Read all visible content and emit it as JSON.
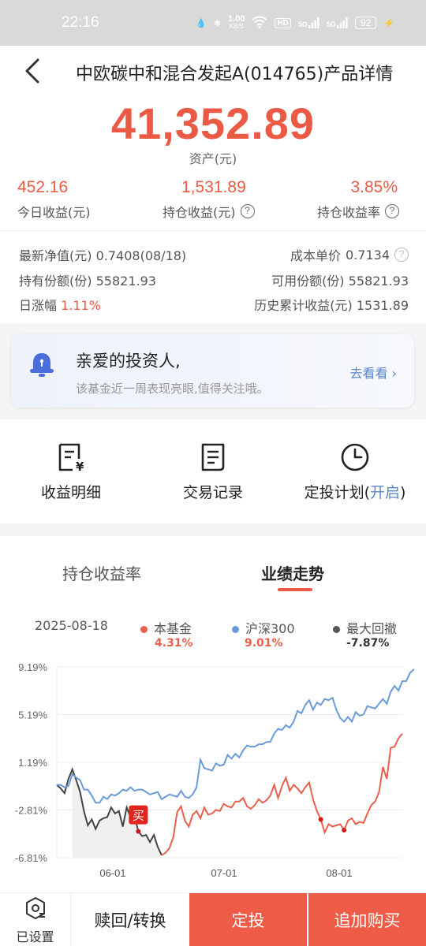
{
  "status_bar": {
    "time": "22:16",
    "net_speed_top": "1.00",
    "net_speed_unit": "KB/S",
    "hd_badge": "HD",
    "sig1": "5G",
    "sig2": "5G",
    "battery": "92"
  },
  "header": {
    "title": "中欧碳中和混合发起A(014765)产品详情"
  },
  "summary": {
    "total_asset": "41,352.89",
    "asset_label": "资产(元)",
    "today_value": "452.16",
    "today_label": "今日收益(元)",
    "holding_value": "1,531.89",
    "holding_label": "持仓收益(元)",
    "rate_value": "3.85%",
    "rate_label": "持仓收益率"
  },
  "details": {
    "nav_label": "最新净值(元)",
    "nav_value": "0.7408(08/18)",
    "cost_label": "成本单价",
    "cost_value": "0.7134",
    "shares_label": "持有份额(份)",
    "shares_value": "55821.93",
    "avail_label": "可用份额(份)",
    "avail_value": "55821.93",
    "daily_label": "日涨幅",
    "daily_value": "1.11%",
    "hist_label": "历史累计收益(元)",
    "hist_value": "1531.89"
  },
  "notice": {
    "title": "亲爱的投资人,",
    "subtitle": "该基金近一周表现亮眼,值得关注哦。",
    "link": "去看看"
  },
  "actions": {
    "earnings": "收益明细",
    "trades": "交易记录",
    "plan": "定投计划(",
    "plan_state": "开启",
    "plan_close": ")"
  },
  "perf": {
    "tab_rate": "持仓收益率",
    "tab_trend": "业绩走势",
    "date": "2025-08-18",
    "buy_marker": "买",
    "legend": [
      {
        "name": "本基金",
        "value": "4.31%",
        "color": "#e8604c"
      },
      {
        "name": "沪深300",
        "value": "9.01%",
        "color": "#6a9bd8"
      },
      {
        "name": "最大回撤",
        "value": "-7.87%",
        "color": "#555555"
      }
    ]
  },
  "chart_data": {
    "type": "line",
    "y_tick_labels": [
      "9.19%",
      "5.19%",
      "1.19%",
      "-2.81%",
      "-6.81%"
    ],
    "x_tick_labels": [
      "06-01",
      "07-01",
      "08-01"
    ],
    "ylim": [
      -6.81,
      9.19
    ],
    "series": [
      {
        "name": "本基金",
        "color": "#e8604c",
        "values": [
          -0.7,
          -1.0,
          -1.4,
          -0.2,
          0.6,
          -0.3,
          -1.3,
          -2.9,
          -4.1,
          -3.6,
          -4.4,
          -3.7,
          -3.5,
          -3.4,
          -2.6,
          -3.1,
          -2.9,
          -4.2,
          -2.6,
          -3.4,
          -3.3,
          -4.6,
          -5.0,
          -4.9,
          -5.5,
          -4.9,
          -5.9,
          -6.6,
          -6.4,
          -6.0,
          -5.1,
          -3.0,
          -2.5,
          -3.7,
          -4.2,
          -3.2,
          -2.9,
          -3.5,
          -2.6,
          -3.2,
          -3.1,
          -2.8,
          -2.9,
          -2.3,
          -2.5,
          -2.6,
          -2.1,
          -2.1,
          -1.8,
          -2.5,
          -2.7,
          -2.4,
          -1.9,
          -2.2,
          -2.0,
          -1.6,
          -0.7,
          -1.8,
          -0.8,
          -0.1,
          -1.2,
          -0.7,
          -1.0,
          -1.4,
          -0.9,
          -0.5,
          -1.9,
          -2.9,
          -3.6,
          -4.7,
          -4.0,
          -4.2,
          -4.1,
          -4.0,
          -4.5,
          -3.7,
          -3.5,
          -4.0,
          -3.8,
          -3.9,
          -3.1,
          -2.4,
          -2.1,
          -1.3,
          0.8,
          -0.2,
          2.4,
          2.5,
          3.2,
          3.6
        ]
      },
      {
        "name": "沪深300",
        "color": "#6a9bd8",
        "values": [
          -0.7,
          -0.7,
          -0.9,
          -0.8,
          0.2,
          -0.1,
          -0.3,
          -1.1,
          -1.1,
          -1.6,
          -2.2,
          -2.2,
          -1.7,
          -1.9,
          -1.5,
          -1.6,
          -1.4,
          -1.1,
          -1.2,
          -0.9,
          -1.2,
          -1.1,
          -1.1,
          -1.3,
          -1.5,
          -1.4,
          -1.3,
          -1.9,
          -1.7,
          -1.5,
          -1.6,
          -1.7,
          -1.2,
          -1.7,
          -1.8,
          -1.5,
          -0.9,
          1.4,
          0.7,
          0.6,
          0.5,
          1.1,
          0.9,
          1.0,
          1.8,
          1.5,
          1.9,
          1.6,
          2.2,
          2.6,
          2.5,
          2.5,
          2.7,
          2.7,
          2.9,
          2.9,
          3.6,
          4.0,
          3.9,
          4.3,
          4.1,
          4.6,
          5.5,
          5.3,
          6.0,
          6.4,
          5.6,
          6.2,
          6.0,
          6.5,
          6.4,
          6.6,
          5.6,
          4.9,
          4.6,
          5.0,
          4.6,
          5.4,
          5.1,
          5.2,
          5.9,
          5.8,
          5.7,
          6.1,
          6.5,
          6.1,
          7.1,
          7.6,
          7.2,
          8.0,
          8.0,
          8.7,
          9.0
        ]
      }
    ]
  }
}
